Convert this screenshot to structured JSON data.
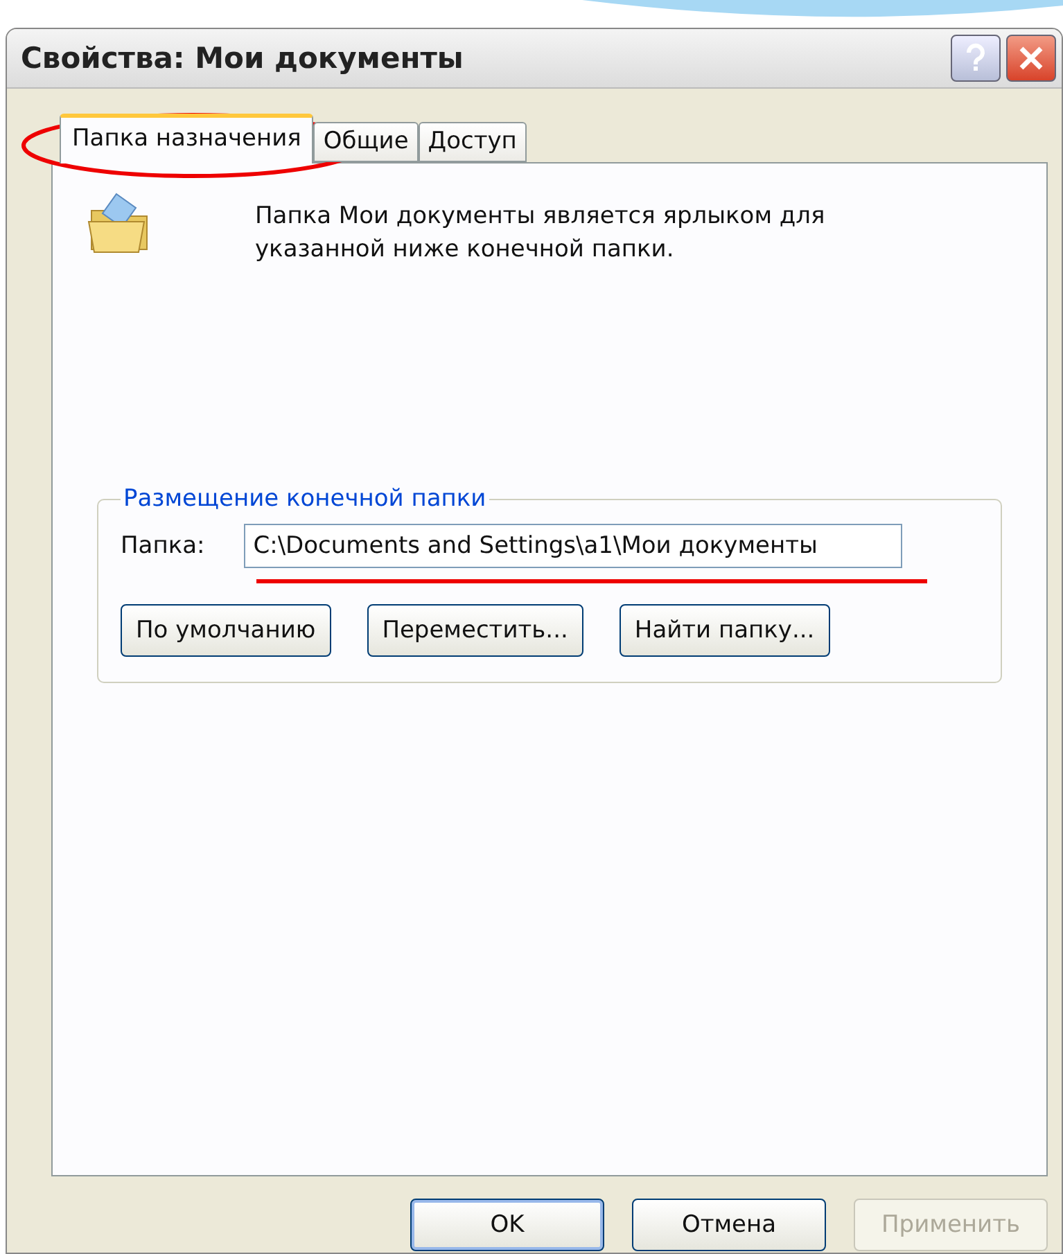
{
  "window": {
    "title": "Свойства: Мои документы"
  },
  "tabs": [
    {
      "label": "Папка назначения",
      "selected": true
    },
    {
      "label": "Общие",
      "selected": false
    },
    {
      "label": "Доступ",
      "selected": false
    }
  ],
  "description": "Папка Мои документы является ярлыком для указанной ниже конечной папки.",
  "group": {
    "title": "Размещение конечной папки",
    "field_label": "Папка:",
    "field_value": "C:\\Documents and Settings\\a1\\Мои документы",
    "buttons": [
      {
        "label": "По умолчанию",
        "disabled": false
      },
      {
        "label": "Переместить...",
        "disabled": false
      },
      {
        "label": "Найти папку...",
        "disabled": false
      }
    ]
  },
  "footer_buttons": [
    {
      "label": "OK",
      "disabled": false,
      "default": true
    },
    {
      "label": "Отмена",
      "disabled": false,
      "default": false
    },
    {
      "label": "Применить",
      "disabled": true,
      "default": false
    }
  ]
}
